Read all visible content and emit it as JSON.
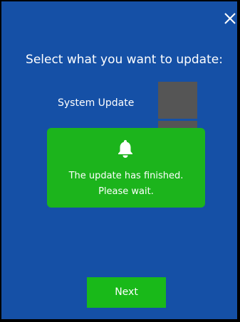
{
  "dialog": {
    "close_icon": "close-icon",
    "heading": "Select what you want to update:"
  },
  "options": [
    {
      "label": "System Update"
    }
  ],
  "notification": {
    "icon": "bell-icon",
    "message_line1": "The update has finished.",
    "message_line2": "Please wait."
  },
  "footer": {
    "next_label": "Next"
  },
  "colors": {
    "background": "#1550a6",
    "toast": "#1cb41c",
    "next_button": "#19b919",
    "placeholder_box": "#555555"
  }
}
